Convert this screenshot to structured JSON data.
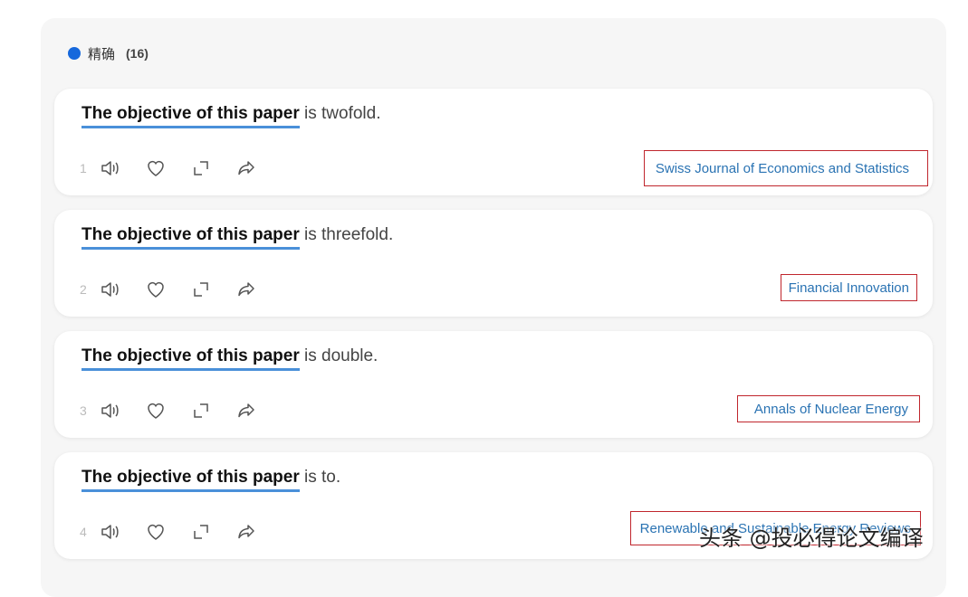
{
  "header": {
    "label": "精确",
    "count": "(16)"
  },
  "colors": {
    "accent": "#1668dc",
    "underline": "#4a90d9",
    "link": "#2a73b3",
    "source_border": "#c0262d"
  },
  "icons": [
    "speaker-icon",
    "heart-icon",
    "expand-icon",
    "share-icon"
  ],
  "results": [
    {
      "number": "1",
      "phrase": "The objective of this paper",
      "rest": " is twofold.",
      "source": "Swiss Journal of Economics and Statistics"
    },
    {
      "number": "2",
      "phrase": "The objective of this paper",
      "rest": " is threefold.",
      "source": "Financial Innovation"
    },
    {
      "number": "3",
      "phrase": "The objective of this paper",
      "rest": " is double.",
      "source": "Annals of Nuclear Energy"
    },
    {
      "number": "4",
      "phrase": "The objective of this paper",
      "rest": " is to.",
      "source": "Renewable and Sustainable Energy Reviews"
    }
  ],
  "watermark": "头条 @投必得论文编译"
}
